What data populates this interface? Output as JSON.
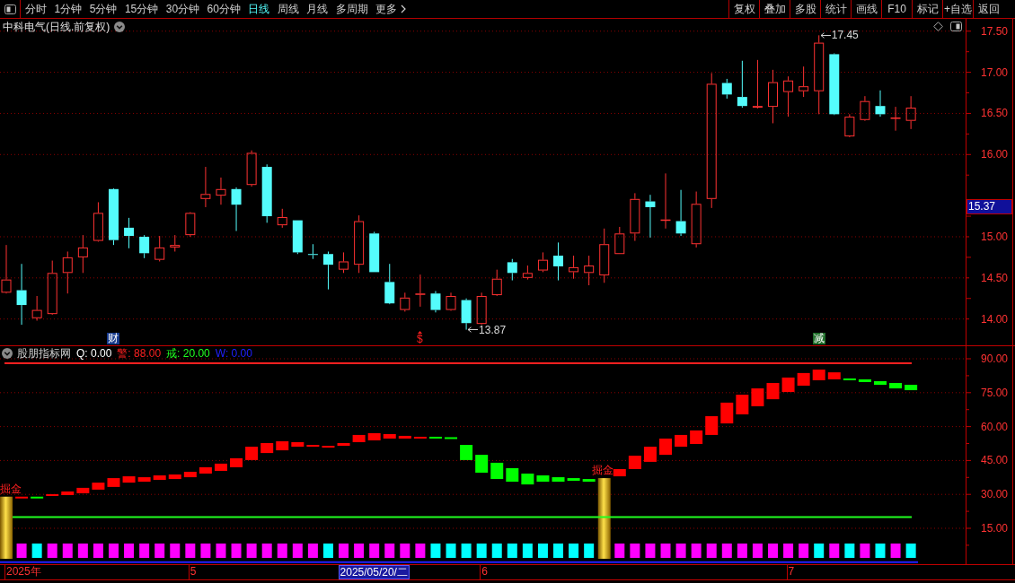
{
  "toolbar": {
    "periods": [
      {
        "label": "分时",
        "selected": false,
        "kind": "period"
      },
      {
        "label": "1分钟",
        "selected": false,
        "kind": "period"
      },
      {
        "label": "5分钟",
        "selected": false,
        "kind": "period"
      },
      {
        "label": "15分钟",
        "selected": false,
        "kind": "period"
      },
      {
        "label": "30分钟",
        "selected": false,
        "kind": "period"
      },
      {
        "label": "60分钟",
        "selected": false,
        "kind": "period"
      },
      {
        "label": "日线",
        "selected": true,
        "kind": "period"
      },
      {
        "label": "周线",
        "selected": false,
        "kind": "period"
      },
      {
        "label": "月线",
        "selected": false,
        "kind": "period"
      },
      {
        "label": "多周期",
        "selected": false,
        "kind": "period"
      },
      {
        "label": "更多",
        "selected": false,
        "kind": "menu"
      }
    ],
    "actions": [
      "复权",
      "叠加",
      "多股",
      "统计",
      "画线",
      "F10",
      "标记",
      "+自选",
      "返回"
    ]
  },
  "price_panel": {
    "title": "中科电气(日线.前复权)",
    "axis_labels": [
      "17.50",
      "17.00",
      "16.50",
      "16.00",
      "15.00",
      "14.50",
      "14.00"
    ],
    "price_tag": "15.37",
    "high_label": "17.45",
    "low_label": "13.87",
    "event_markers": [
      {
        "text": "财",
        "kind": "badge",
        "color": "#173a8c"
      },
      {
        "text": "$",
        "kind": "glyph",
        "color": "#ff2020"
      },
      {
        "text": "减",
        "kind": "badge",
        "color": "#1f6e2a"
      }
    ]
  },
  "indicator_panel": {
    "name": "股朋指标网",
    "legend": [
      {
        "text": "Q: 0.00",
        "color": "#ffffff"
      },
      {
        "text": "警: 88.00",
        "color": "#ff2020"
      },
      {
        "text": "戒: 20.00",
        "color": "#20ff20"
      },
      {
        "text": "W: 0.00",
        "color": "#2020ff"
      }
    ],
    "axis_labels": [
      "90.00",
      "75.00",
      "60.00",
      "45.00",
      "30.00",
      "15.00"
    ],
    "squares": [
      {
        "kind": "signal",
        "label": "掘金"
      },
      {
        "kind": "square",
        "color": "#ff00ff"
      },
      {
        "kind": "square",
        "color": "#00ffff"
      },
      {
        "kind": "square",
        "color": "#ff00ff"
      },
      {
        "kind": "square",
        "color": "#ff00ff"
      },
      {
        "kind": "square",
        "color": "#ff00ff"
      },
      {
        "kind": "square",
        "color": "#ff00ff"
      },
      {
        "kind": "square",
        "color": "#ff00ff"
      },
      {
        "kind": "square",
        "color": "#ff00ff"
      },
      {
        "kind": "square",
        "color": "#ff00ff"
      },
      {
        "kind": "square",
        "color": "#ff00ff"
      },
      {
        "kind": "square",
        "color": "#ff00ff"
      },
      {
        "kind": "square",
        "color": "#ff00ff"
      },
      {
        "kind": "square",
        "color": "#ff00ff"
      },
      {
        "kind": "square",
        "color": "#ff00ff"
      },
      {
        "kind": "square",
        "color": "#ff00ff"
      },
      {
        "kind": "square",
        "color": "#ff00ff"
      },
      {
        "kind": "square",
        "color": "#ff00ff"
      },
      {
        "kind": "square",
        "color": "#ff00ff"
      },
      {
        "kind": "square",
        "color": "#ff00ff"
      },
      {
        "kind": "square",
        "color": "#ff00ff"
      },
      {
        "kind": "square",
        "color": "#00ffff"
      },
      {
        "kind": "square",
        "color": "#ff00ff"
      },
      {
        "kind": "square",
        "color": "#ff00ff"
      },
      {
        "kind": "square",
        "color": "#ff00ff"
      },
      {
        "kind": "square",
        "color": "#ff00ff"
      },
      {
        "kind": "square",
        "color": "#ff00ff"
      },
      {
        "kind": "square",
        "color": "#ff00ff"
      },
      {
        "kind": "square",
        "color": "#00ffff"
      },
      {
        "kind": "square",
        "color": "#00ffff"
      },
      {
        "kind": "square",
        "color": "#00ffff"
      },
      {
        "kind": "square",
        "color": "#00ffff"
      },
      {
        "kind": "square",
        "color": "#00ffff"
      },
      {
        "kind": "square",
        "color": "#00ffff"
      },
      {
        "kind": "square",
        "color": "#00ffff"
      },
      {
        "kind": "square",
        "color": "#00ffff"
      },
      {
        "kind": "square",
        "color": "#00ffff"
      },
      {
        "kind": "square",
        "color": "#00ffff"
      },
      {
        "kind": "square",
        "color": "#00ffff"
      },
      {
        "kind": "signal",
        "label": "掘金"
      },
      {
        "kind": "square",
        "color": "#ff00ff"
      },
      {
        "kind": "square",
        "color": "#ff00ff"
      },
      {
        "kind": "square",
        "color": "#ff00ff"
      },
      {
        "kind": "square",
        "color": "#ff00ff"
      },
      {
        "kind": "square",
        "color": "#ff00ff"
      },
      {
        "kind": "square",
        "color": "#ff00ff"
      },
      {
        "kind": "square",
        "color": "#ff00ff"
      },
      {
        "kind": "square",
        "color": "#ff00ff"
      },
      {
        "kind": "square",
        "color": "#ff00ff"
      },
      {
        "kind": "square",
        "color": "#ff00ff"
      },
      {
        "kind": "square",
        "color": "#ff00ff"
      },
      {
        "kind": "square",
        "color": "#ff00ff"
      },
      {
        "kind": "square",
        "color": "#ff00ff"
      },
      {
        "kind": "square",
        "color": "#00ffff"
      },
      {
        "kind": "square",
        "color": "#ff00ff"
      },
      {
        "kind": "square",
        "color": "#00ffff"
      },
      {
        "kind": "square",
        "color": "#ff00ff"
      },
      {
        "kind": "square",
        "color": "#00ffff"
      },
      {
        "kind": "square",
        "color": "#ff00ff"
      },
      {
        "kind": "square",
        "color": "#00ffff"
      }
    ]
  },
  "time_axis": {
    "labels": [
      "2025年",
      "5",
      "6",
      "7"
    ],
    "cursor_date": "2025/05/20/二"
  }
}
